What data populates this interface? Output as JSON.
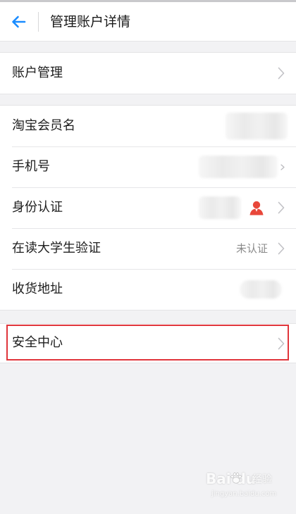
{
  "header": {
    "title": "管理账户详情",
    "back_icon": "arrow-left-icon"
  },
  "sections": [
    {
      "rows": [
        {
          "label": "账户管理",
          "value": "",
          "chevron": true
        }
      ]
    },
    {
      "rows": [
        {
          "label": "淘宝会员名",
          "value": "",
          "chevron": false
        },
        {
          "label": "手机号",
          "value": "",
          "chevron": true
        },
        {
          "label": "身份认证",
          "value": "",
          "chevron": true,
          "icon": "person-avatar-icon"
        },
        {
          "label": "在读大学生验证",
          "value": "未认证",
          "chevron": true
        },
        {
          "label": "收货地址",
          "value": "",
          "chevron": false
        }
      ]
    },
    {
      "rows": [
        {
          "label": "安全中心",
          "value": "",
          "chevron": true,
          "highlighted": true
        }
      ]
    }
  ],
  "colors": {
    "accent": "#1a8cff",
    "highlight_border": "#e0353b",
    "avatar": "#e8473a",
    "background": "#f2f2f4"
  },
  "watermark": {
    "brand": "Bai du",
    "site": "jingyan.baidu.com",
    "label": "经验"
  }
}
